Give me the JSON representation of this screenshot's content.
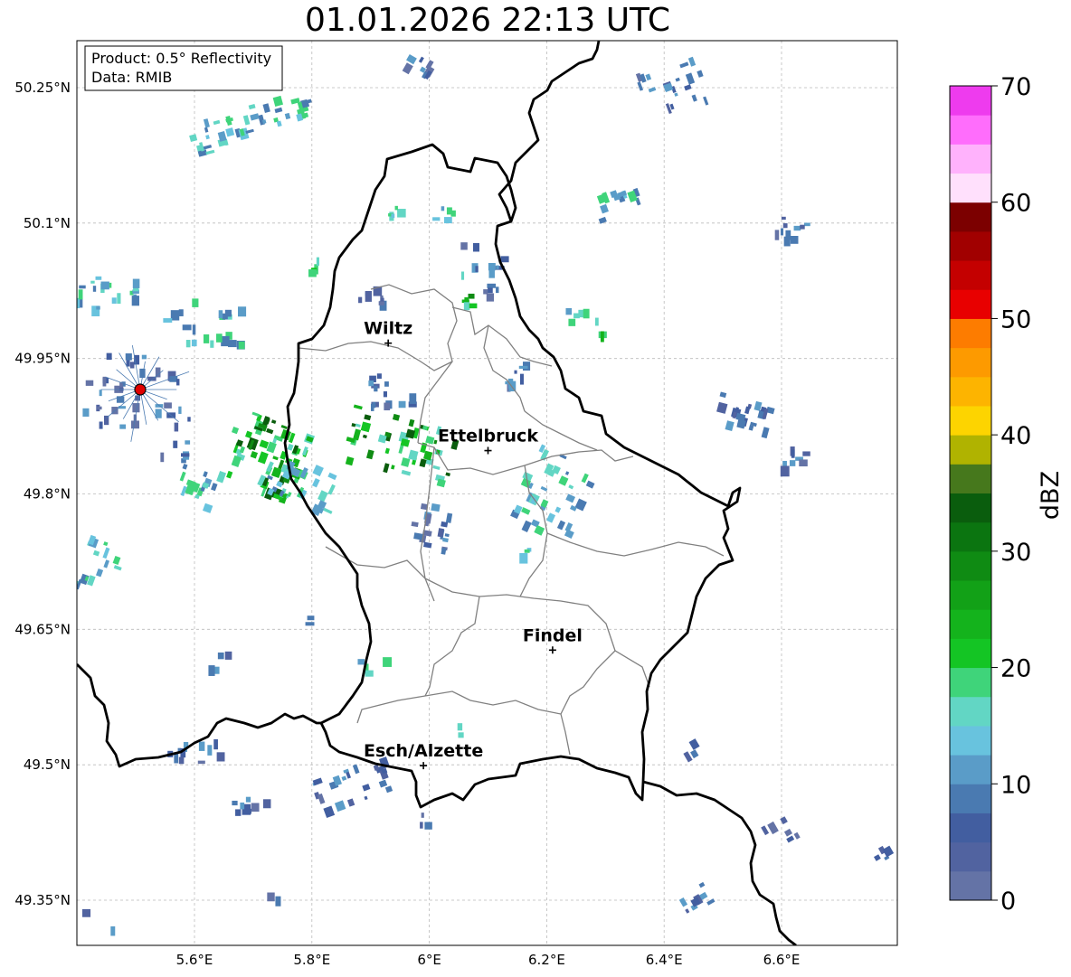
{
  "title": "01.01.2026 22:13 UTC",
  "info": {
    "product": "Product: 0.5° Reflectivity",
    "data": "Data: RMIB"
  },
  "axes": {
    "lon_ticks": [
      {
        "lon": 5.6,
        "label": "5.6°E"
      },
      {
        "lon": 5.8,
        "label": "5.8°E"
      },
      {
        "lon": 6.0,
        "label": "6°E"
      },
      {
        "lon": 6.2,
        "label": "6.2°E"
      },
      {
        "lon": 6.4,
        "label": "6.4°E"
      },
      {
        "lon": 6.6,
        "label": "6.6°E"
      }
    ],
    "lat_ticks": [
      {
        "lat": 50.25,
        "label": "50.25°N"
      },
      {
        "lat": 50.1,
        "label": "50.1°N"
      },
      {
        "lat": 49.95,
        "label": "49.95°N"
      },
      {
        "lat": 49.8,
        "label": "49.8°N"
      },
      {
        "lat": 49.65,
        "label": "49.65°N"
      },
      {
        "lat": 49.5,
        "label": "49.5°N"
      },
      {
        "lat": 49.35,
        "label": "49.35°N"
      }
    ]
  },
  "cities": [
    {
      "name": "Wiltz",
      "lon": 5.93,
      "lat": 49.967
    },
    {
      "name": "Ettelbruck",
      "lon": 6.1,
      "lat": 49.848
    },
    {
      "name": "Findel",
      "lon": 6.21,
      "lat": 49.627
    },
    {
      "name": "Esch/Alzette",
      "lon": 5.99,
      "lat": 49.499
    }
  ],
  "radar_site": {
    "lon": 5.505,
    "lat": 49.915
  },
  "colorbar": {
    "title": "dBZ",
    "ticks": [
      "0",
      "10",
      "20",
      "30",
      "40",
      "50",
      "60",
      "70"
    ],
    "colors": [
      "#6473a6",
      "#5163a0",
      "#425ea0",
      "#4a7ab1",
      "#5a9cc8",
      "#68c3de",
      "#62d6c4",
      "#3fd47a",
      "#14c524",
      "#14b31c",
      "#12a117",
      "#0f8b13",
      "#0b7510",
      "#0a5d0d",
      "#46781c",
      "#b0b300",
      "#fdd400",
      "#fdb400",
      "#fd9a00",
      "#fd7c00",
      "#e80000",
      "#c40000",
      "#a10000",
      "#7c0000",
      "#ffe0fc",
      "#ffb2fc",
      "#ff6dfc",
      "#ee3bee"
    ]
  }
}
